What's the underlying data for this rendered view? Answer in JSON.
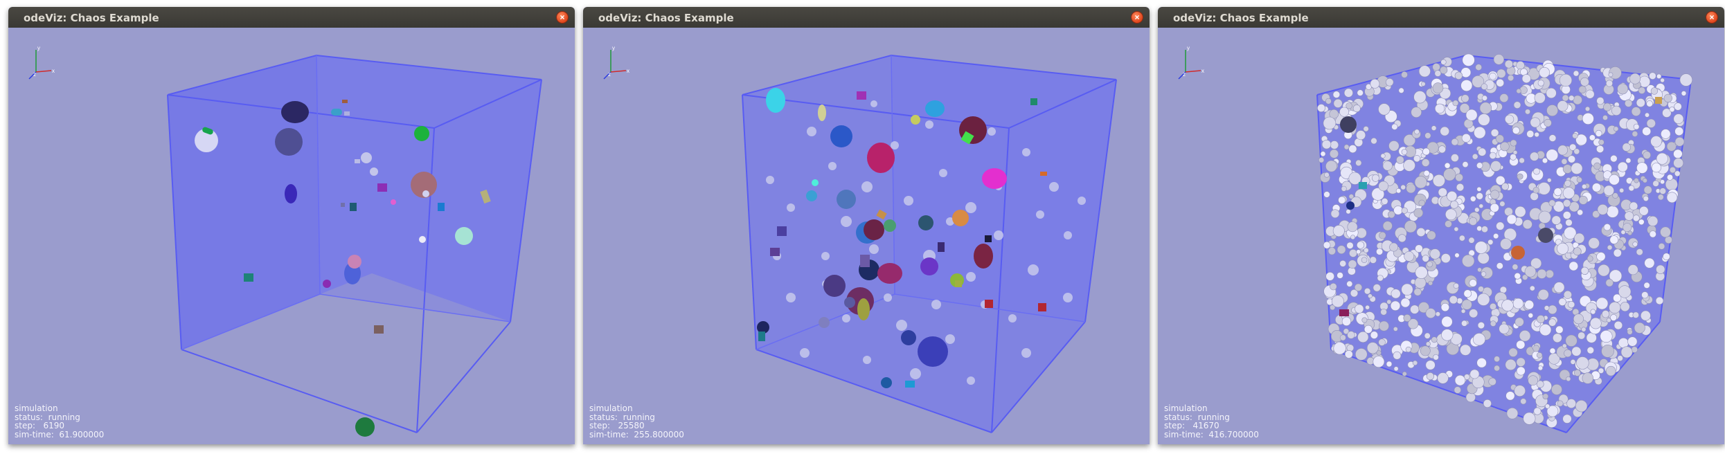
{
  "windows": [
    {
      "title": "odeViz: Chaos Example",
      "hud": {
        "heading": "simulation",
        "status_label": "status:",
        "status": "running",
        "step_label": "step:",
        "step": "6190",
        "time_label": "sim-time:",
        "time": "61.900000"
      }
    },
    {
      "title": "odeViz: Chaos Example",
      "hud": {
        "heading": "simulation",
        "status_label": "status:",
        "status": "running",
        "step_label": "step:",
        "step": "25580",
        "time_label": "sim-time:",
        "time": "255.800000"
      }
    },
    {
      "title": "odeViz: Chaos Example",
      "hud": {
        "heading": "simulation",
        "status_label": "status:",
        "status": "running",
        "step_label": "step:",
        "step": "41670",
        "time_label": "sim-time:",
        "time": "416.700000"
      }
    }
  ],
  "axis_labels": {
    "x": "x",
    "y": "y",
    "z": "z"
  },
  "close_glyph": "×",
  "colors": {
    "background": "#9a9ccd",
    "box_face": "#6b6ff3",
    "box_edge": "#5b5ff0",
    "titlebar": "#3c3b37",
    "close": "#e0451c"
  }
}
